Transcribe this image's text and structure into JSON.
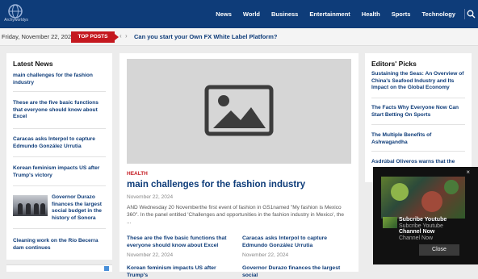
{
  "site": {
    "logo_text": "Archyworldys"
  },
  "nav": {
    "items": [
      "News",
      "World",
      "Business",
      "Entertainment",
      "Health",
      "Sports",
      "Technology"
    ]
  },
  "ticker": {
    "date": "Friday, November 22, 2024",
    "label": "TOP POSTS",
    "prev": "‹",
    "next": "›",
    "headline": "Can you start your Own FX White Label Platform?"
  },
  "latest_news": {
    "title": "Latest News",
    "items": [
      "main challenges for the fashion industry",
      "These are the five basic functions that everyone should know about Excel",
      "Caracas asks Interpol to capture Edmundo González Urrutia",
      "Korean feminism impacts US after Trump's victory",
      "Governor Durazo finances the largest social budget in the history of Sonora",
      "Cleaning work on the Río Becerra dam continues"
    ]
  },
  "featured": {
    "category": "HEALTH",
    "title": "main challenges for the fashion industry",
    "date": "November 22, 2024",
    "excerpt": "AND Wednesday 20 Novemberthe first event of fashion in GS1named \"My fashion is Mexico 360\". In the panel entitled 'Challenges and opportunities in the fashion industry in Mexico', the ..."
  },
  "sub_articles": [
    {
      "title": "These are the five basic functions that everyone should know about Excel",
      "date": "November 22, 2024"
    },
    {
      "title": "Caracas asks Interpol to capture Edmundo González Urrutia",
      "date": "November 22, 2024"
    },
    {
      "title": "Korean feminism impacts US after Trump's"
    },
    {
      "title": "Governor Durazo finances the largest social"
    }
  ],
  "editors_picks": {
    "title": "Editors' Picks",
    "items": [
      "Sustaining the Seas: An Overview of China's Seafood Industry and Its Impact on the Global Economy",
      "The Facts Why Everyone Now Can Start Betting On Sports",
      "The Multiple Benefits of Ashwagandha",
      "Asdrúbal Oliveros warns that the"
    ]
  },
  "video": {
    "line1": "Subcribe Youtube",
    "line2": "Subcribe Youtube",
    "line3": "Channel Now",
    "line4": "Channel Now",
    "close_label": "Close",
    "close_x": "×"
  },
  "colors": {
    "nav_bg": "#0e3c79",
    "accent": "#c4181f",
    "link": "#0e3c79"
  }
}
